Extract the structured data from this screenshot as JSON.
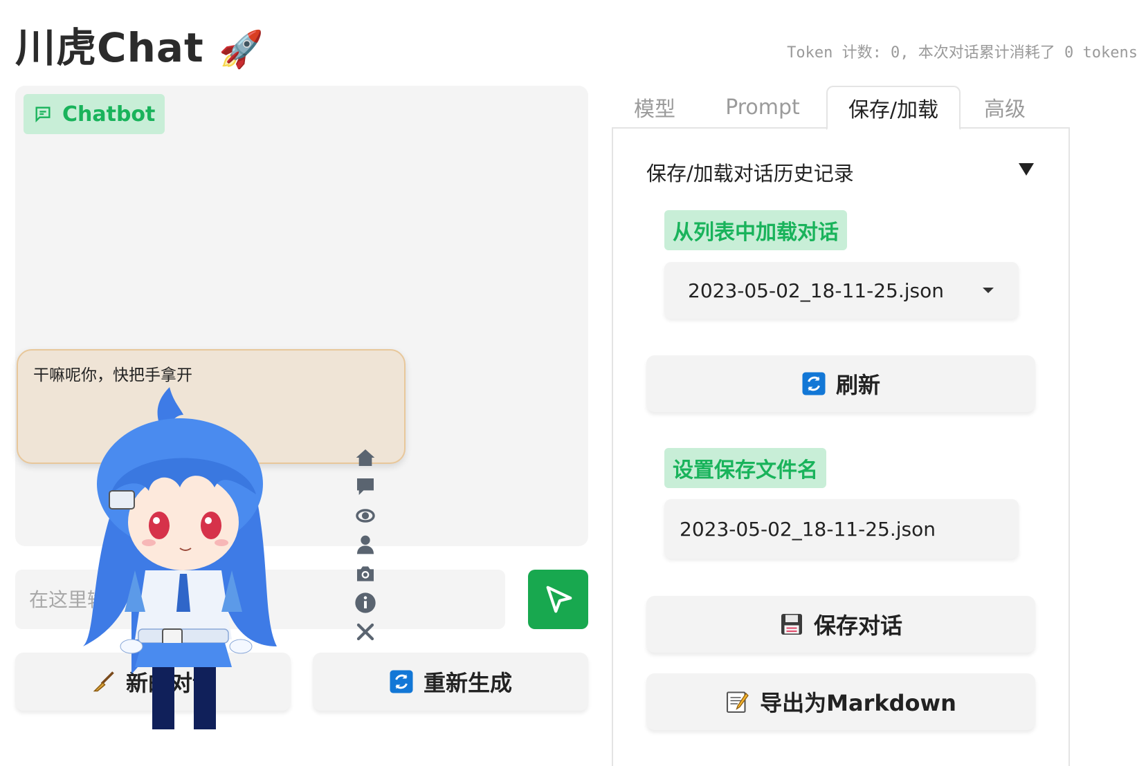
{
  "app": {
    "title": "川虎Chat",
    "title_emoji": "🚀",
    "token_info": "Token 计数: 0, 本次对话累计消耗了 0 tokens"
  },
  "chat": {
    "badge_label": "Chatbot",
    "input_placeholder": "在这里输入",
    "new_chat_label": "新的对话",
    "regenerate_label": "重新生成"
  },
  "mascot": {
    "speech": "干嘛呢你，快把手拿开",
    "tools": [
      "home-icon",
      "comment-icon",
      "eye-icon",
      "user-icon",
      "camera-icon",
      "info-icon",
      "close-icon"
    ]
  },
  "tabs": [
    {
      "label": "模型",
      "active": false
    },
    {
      "label": "Prompt",
      "active": false
    },
    {
      "label": "保存/加载",
      "active": true
    },
    {
      "label": "高级",
      "active": false
    }
  ],
  "save_load": {
    "section_title": "保存/加载对话历史记录",
    "load_label": "从列表中加载对话",
    "selected_file": "2023-05-02_18-11-25.json",
    "refresh_label": "刷新",
    "filename_label": "设置保存文件名",
    "filename_value": "2023-05-02_18-11-25.json",
    "save_label": "保存对话",
    "export_label": "导出为Markdown"
  },
  "colors": {
    "accent_green": "#19b35b",
    "badge_bg": "#c8eed7",
    "send_button": "#18a84f",
    "panel_bg": "#f4f4f4"
  }
}
